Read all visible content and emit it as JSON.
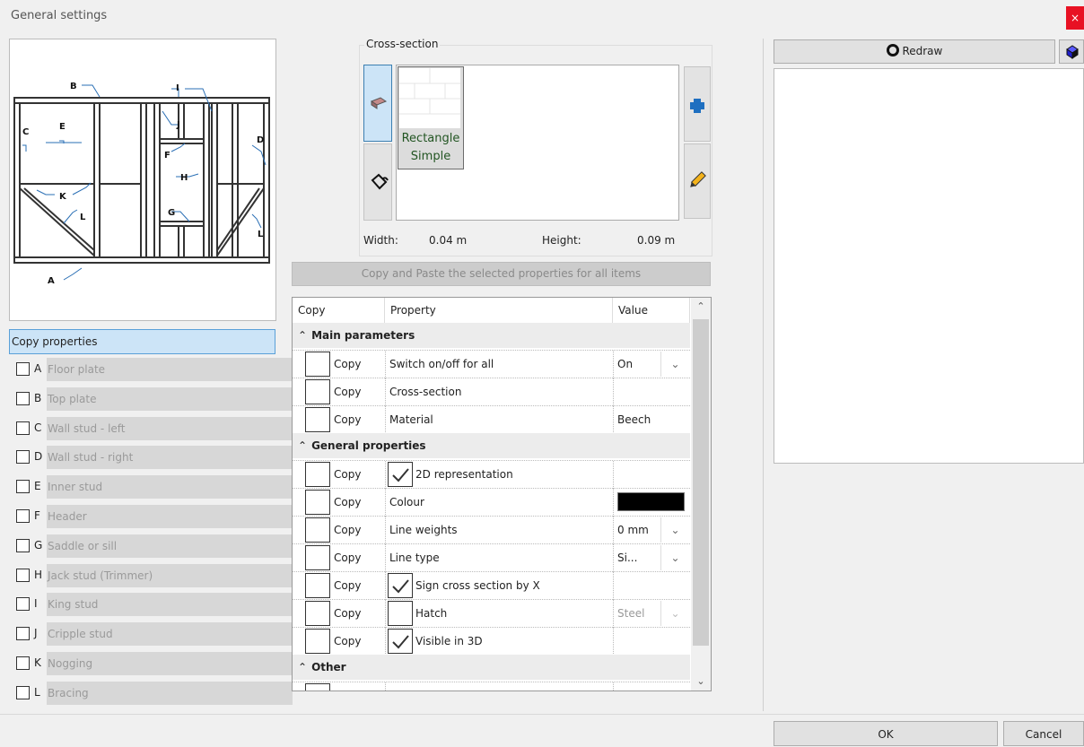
{
  "window": {
    "title": "General settings",
    "close": "×"
  },
  "diagram_labels": {
    "A": "A",
    "B": "B",
    "C": "C",
    "D": "D",
    "E": "E",
    "F": "F",
    "G": "G",
    "H": "H",
    "I": "I",
    "J": "J",
    "K": "K",
    "L": "L"
  },
  "copy_properties": {
    "title": "Copy properties",
    "items": [
      {
        "letter": "A",
        "label": "Floor plate"
      },
      {
        "letter": "B",
        "label": "Top plate"
      },
      {
        "letter": "C",
        "label": "Wall stud - left"
      },
      {
        "letter": "D",
        "label": "Wall stud - right"
      },
      {
        "letter": "E",
        "label": "Inner stud"
      },
      {
        "letter": "F",
        "label": "Header"
      },
      {
        "letter": "G",
        "label": "Saddle or sill"
      },
      {
        "letter": "H",
        "label": "Jack stud (Trimmer)"
      },
      {
        "letter": "I",
        "label": "King stud"
      },
      {
        "letter": "J",
        "label": "Cripple stud"
      },
      {
        "letter": "K",
        "label": "Nogging"
      },
      {
        "letter": "L",
        "label": "Bracing"
      }
    ]
  },
  "cross_section": {
    "legend": "Cross-section",
    "card_label": "Rectangle Simple",
    "width_label": "Width:",
    "width_value": "0.04 m",
    "height_label": "Height:",
    "height_value": "0.09 m",
    "copy_paste_label": "Copy and Paste the selected properties for all items"
  },
  "grid": {
    "headers": {
      "copy": "Copy",
      "property": "Property",
      "value": "Value"
    },
    "sections": [
      {
        "title": "Main parameters",
        "rows": [
          {
            "copy": "Copy",
            "property": "Switch on/off for all",
            "value": "On",
            "dropdown": true
          },
          {
            "copy": "Copy",
            "property": "Cross-section",
            "value": ""
          },
          {
            "copy": "Copy",
            "property": "Material",
            "value": "Beech"
          }
        ]
      },
      {
        "title": "General properties",
        "rows": [
          {
            "copy": "Copy",
            "property": "2D representation",
            "checked": true
          },
          {
            "copy": "Copy",
            "property": "Colour",
            "color": "#000000"
          },
          {
            "copy": "Copy",
            "property": "Line weights",
            "value": "0 mm",
            "dropdown": true
          },
          {
            "copy": "Copy",
            "property": "Line type",
            "value": "Si...",
            "dropdown": true
          },
          {
            "copy": "Copy",
            "property": "Sign cross section by X",
            "checked": true
          },
          {
            "copy": "Copy",
            "property": "Hatch",
            "checked": false,
            "value": "Steel",
            "dropdown": true,
            "disabled": true
          },
          {
            "copy": "Copy",
            "property": "Visible in 3D",
            "checked": true
          }
        ]
      },
      {
        "title": "Other",
        "rows": []
      }
    ]
  },
  "right_panel": {
    "redraw_label": "Redraw"
  },
  "footer": {
    "ok": "OK",
    "cancel": "Cancel"
  },
  "colors": {
    "accent": "#cce4f7",
    "accent_border": "#3c7fb1",
    "close": "#e81123",
    "add_icon": "#1e6fc0",
    "edit_icon": "#e8a21a"
  }
}
